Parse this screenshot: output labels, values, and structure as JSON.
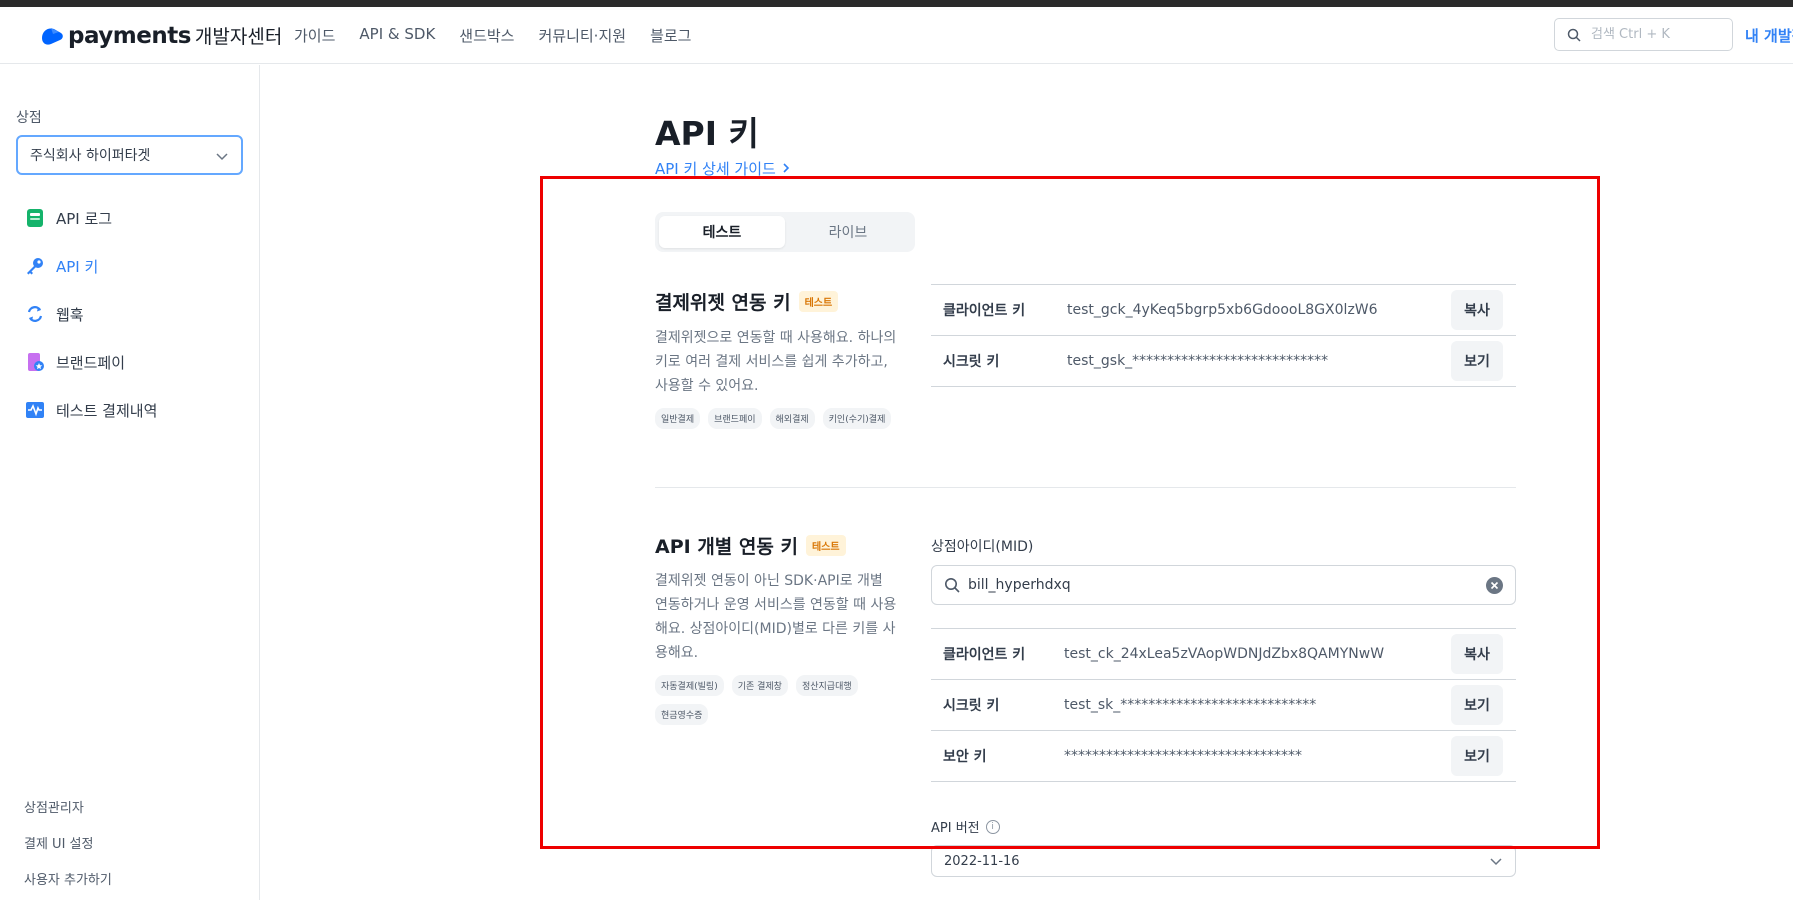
{
  "header": {
    "logo_word": "payments",
    "logo_sub": "개발자센터",
    "nav": [
      "가이드",
      "API & SDK",
      "샌드박스",
      "커뮤니티·지원",
      "블로그"
    ],
    "search_placeholder": "검색 Ctrl + K",
    "my_dev": "내 개발정보"
  },
  "sidebar": {
    "store_label": "상점",
    "store_value": "주식회사 하이퍼타겟",
    "menu": [
      {
        "label": "API 로그",
        "icon": "log-icon"
      },
      {
        "label": "API 키",
        "icon": "key-icon"
      },
      {
        "label": "웹훅",
        "icon": "webhook-icon"
      },
      {
        "label": "브랜드페이",
        "icon": "brandpay-icon"
      },
      {
        "label": "테스트 결제내역",
        "icon": "test-payment-icon"
      }
    ],
    "bottom_links": [
      "상점관리자",
      "결제 UI 설정",
      "사용자 추가하기"
    ]
  },
  "main": {
    "title": "API 키",
    "guide_link": "API 키 상세 가이드",
    "tabs": [
      "테스트",
      "라이브"
    ],
    "widget": {
      "title": "결제위젯 연동 키",
      "badge": "테스트",
      "desc": "결제위젯으로 연동할 때 사용해요. 하나의 키로 여러 결제 서비스를 쉽게 추가하고, 사용할 수 있어요.",
      "tags": [
        "일반결제",
        "브랜드페이",
        "해외결제",
        "키인(수기)결제"
      ],
      "rows": [
        {
          "label": "클라이언트 키",
          "value": "test_gck_4yKeq5bgrp5xb6GdoooL8GX0lzW6",
          "button": "복사"
        },
        {
          "label": "시크릿 키",
          "value": "test_gsk_****************************",
          "button": "보기"
        }
      ]
    },
    "api": {
      "title": "API 개별 연동 키",
      "badge": "테스트",
      "desc": "결제위젯 연동이 아닌 SDK·API로 개별 연동하거나 운영 서비스를 연동할 때 사용해요. 상점아이디(MID)별로 다른 키를 사용해요.",
      "tags": [
        "자동결제(빌링)",
        "기존 결제창",
        "정산지급대행",
        "현금영수증"
      ],
      "mid_label": "상점아이디(MID)",
      "mid_value": "bill_hyperhdxq",
      "rows": [
        {
          "label": "클라이언트 키",
          "value": "test_ck_24xLea5zVAopWDNJdZbx8QAMYNwW",
          "button": "복사"
        },
        {
          "label": "시크릿 키",
          "value": "test_sk_****************************",
          "button": "보기"
        },
        {
          "label": "보안 키",
          "value": "**********************************",
          "button": "보기"
        }
      ],
      "api_version_label": "API 버전",
      "api_version_value": "2022-11-16"
    }
  },
  "colors": {
    "accent": "#3182f6",
    "highlight_border": "#ee0000",
    "badge_text": "#d97706",
    "badge_bg": "#fff3d9"
  }
}
